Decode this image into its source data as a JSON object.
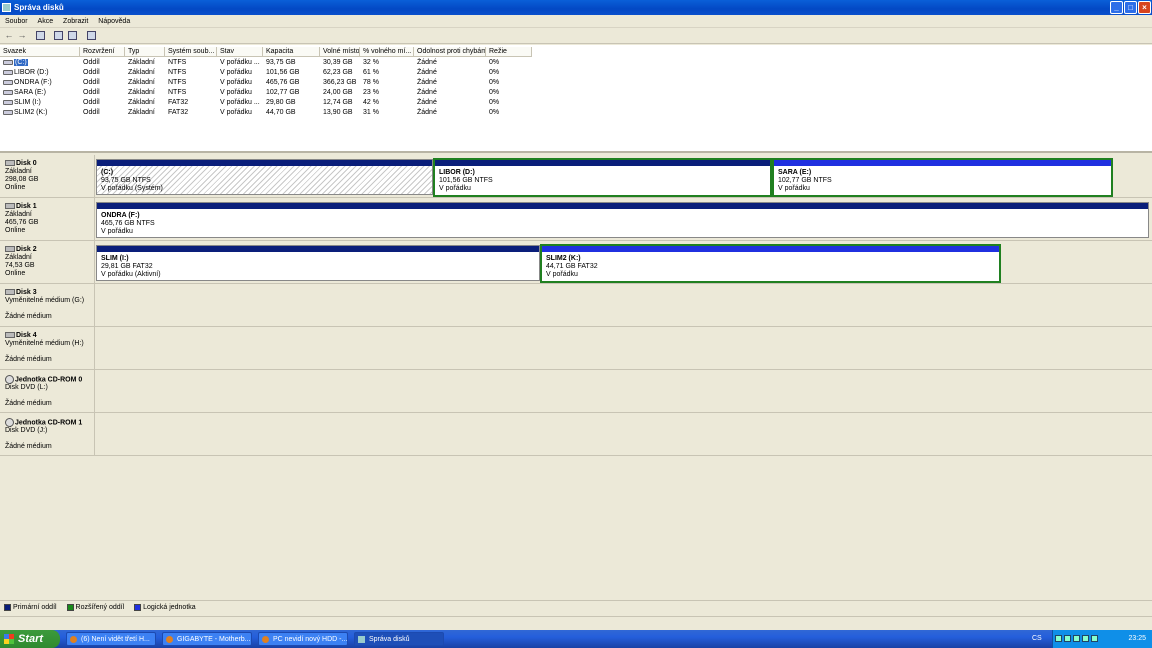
{
  "window": {
    "title": "Správa disků"
  },
  "menu": [
    "Soubor",
    "Akce",
    "Zobrazit",
    "Nápověda"
  ],
  "toolbar": {
    "back": "←",
    "forward": "→"
  },
  "list": {
    "columns": [
      "Svazek",
      "Rozvržení",
      "Typ",
      "Systém soub...",
      "Stav",
      "Kapacita",
      "Volné místo",
      "% volného mí...",
      "Odolnost proti chybám",
      "Režie"
    ],
    "rows": [
      [
        "(C:)",
        "Oddíl",
        "Základní",
        "NTFS",
        "V pořádku ...",
        "93,75 GB",
        "30,39 GB",
        "32 %",
        "Žádné",
        "0%"
      ],
      [
        "LIBOR (D:)",
        "Oddíl",
        "Základní",
        "NTFS",
        "V pořádku",
        "101,56 GB",
        "62,23 GB",
        "61 %",
        "Žádné",
        "0%"
      ],
      [
        "ONDRA (F:)",
        "Oddíl",
        "Základní",
        "NTFS",
        "V pořádku",
        "465,76 GB",
        "366,23 GB",
        "78 %",
        "Žádné",
        "0%"
      ],
      [
        "SARA (E:)",
        "Oddíl",
        "Základní",
        "NTFS",
        "V pořádku",
        "102,77 GB",
        "24,00 GB",
        "23 %",
        "Žádné",
        "0%"
      ],
      [
        "SLIM (I:)",
        "Oddíl",
        "Základní",
        "FAT32",
        "V pořádku ...",
        "29,80 GB",
        "12,74 GB",
        "42 %",
        "Žádné",
        "0%"
      ],
      [
        "SLIM2 (K:)",
        "Oddíl",
        "Základní",
        "FAT32",
        "V pořádku",
        "44,70 GB",
        "13,90 GB",
        "31 %",
        "Žádné",
        "0%"
      ]
    ]
  },
  "disks": [
    {
      "name": "Disk 0",
      "lines": [
        "Základní",
        "298,08 GB",
        "Online"
      ],
      "parts": [
        {
          "name": "(C:)",
          "size": "93,75 GB NTFS",
          "status": "V pořádku (Systém)"
        },
        {
          "name": "LIBOR (D:)",
          "size": "101,56 GB NTFS",
          "status": "V pořádku"
        },
        {
          "name": "SARA (E:)",
          "size": "102,77 GB NTFS",
          "status": "V pořádku"
        }
      ]
    },
    {
      "name": "Disk 1",
      "lines": [
        "Základní",
        "465,76 GB",
        "Online"
      ],
      "parts": [
        {
          "name": "ONDRA (F:)",
          "size": "465,76 GB NTFS",
          "status": "V pořádku"
        }
      ]
    },
    {
      "name": "Disk 2",
      "lines": [
        "Základní",
        "74,53 GB",
        "Online"
      ],
      "parts": [
        {
          "name": "SLIM (I:)",
          "size": "29,81 GB FAT32",
          "status": "V pořádku (Aktivní)"
        },
        {
          "name": "SLIM2 (K:)",
          "size": "44,71 GB FAT32",
          "status": "V pořádku"
        }
      ]
    },
    {
      "name": "Disk 3",
      "lines": [
        "Vyměnitelné médium (G:)",
        "",
        "Žádné médium"
      ]
    },
    {
      "name": "Disk 4",
      "lines": [
        "Vyměnitelné médium (H:)",
        "",
        "Žádné médium"
      ]
    },
    {
      "name": "Jednotka CD-ROM 0",
      "lines": [
        "Disk DVD (L:)",
        "",
        "Žádné médium"
      ]
    },
    {
      "name": "Jednotka CD-ROM 1",
      "lines": [
        "Disk DVD (J:)",
        "",
        "Žádné médium"
      ]
    }
  ],
  "legend": [
    {
      "label": "Primární oddíl",
      "color": "#0a1e7a"
    },
    {
      "label": "Rozšířený oddíl",
      "color": "#1a8a1a"
    },
    {
      "label": "Logická jednotka",
      "color": "#2030e0"
    }
  ],
  "taskbar": {
    "start": "Start",
    "tasks": [
      "(6) Není vidět třetí H...",
      "GIGABYTE - Motherb...",
      "PC nevidí nový HDD -...",
      "Správa disků"
    ],
    "lang": "CS",
    "clock": "23:25"
  }
}
